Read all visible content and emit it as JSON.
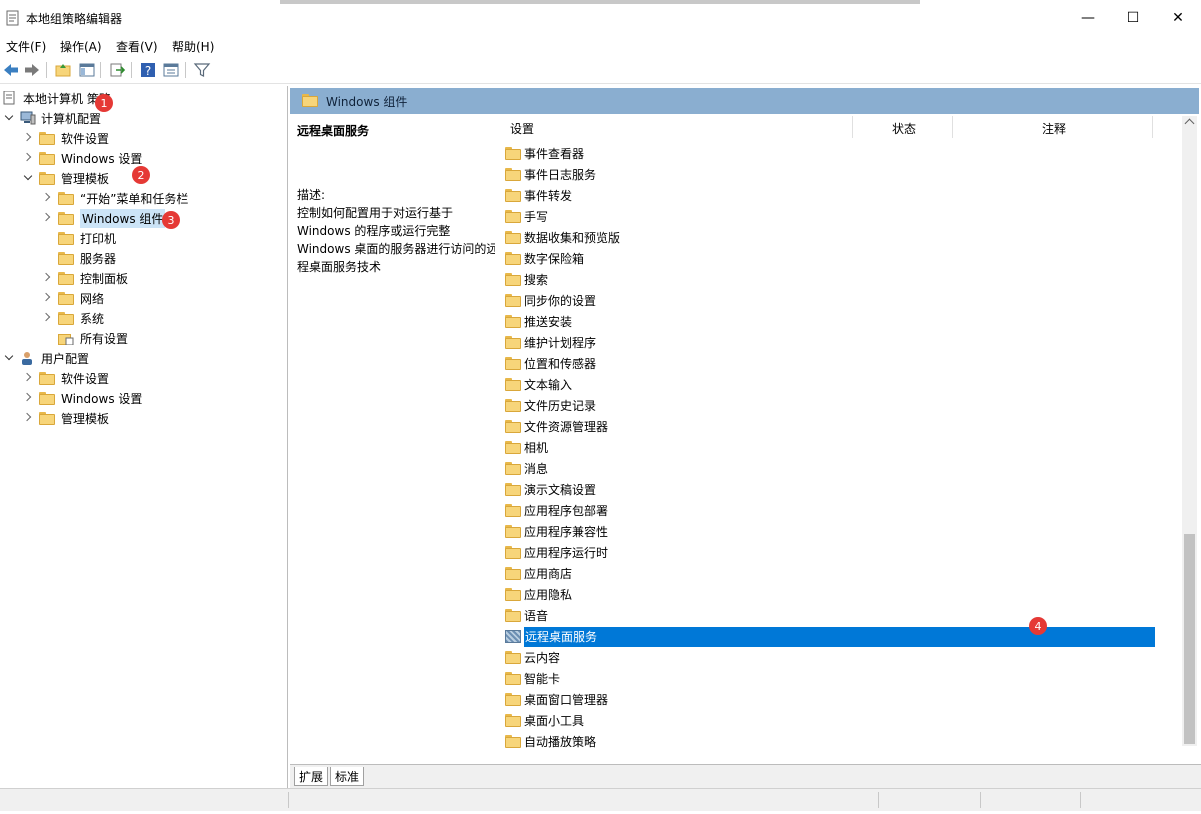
{
  "window": {
    "title": "本地组策略编辑器",
    "minimize": "—",
    "maximize": "☐",
    "close": "✕"
  },
  "menu": [
    "文件(F)",
    "操作(A)",
    "查看(V)",
    "帮助(H)"
  ],
  "toolbar": {
    "icons": [
      "back-arrow-icon",
      "forward-arrow-icon",
      "up-folder-icon",
      "show-hide-tree-icon",
      "export-list-icon",
      "help-icon",
      "properties-icon",
      "filter-icon"
    ]
  },
  "tree": {
    "root": "本地计算机 策略",
    "items": [
      {
        "label": "计算机配置"
      },
      {
        "label": "软件设置"
      },
      {
        "label": "Windows 设置"
      },
      {
        "label": "管理模板"
      },
      {
        "label": "“开始”菜单和任务栏"
      },
      {
        "label": "Windows 组件"
      },
      {
        "label": "打印机"
      },
      {
        "label": "服务器"
      },
      {
        "label": "控制面板"
      },
      {
        "label": "网络"
      },
      {
        "label": "系统"
      },
      {
        "label": "所有设置"
      },
      {
        "label": "用户配置"
      },
      {
        "label": "软件设置"
      },
      {
        "label": "Windows 设置"
      },
      {
        "label": "管理模板"
      }
    ]
  },
  "badges": [
    "1",
    "2",
    "3",
    "4"
  ],
  "right": {
    "header_title": "Windows 组件",
    "desc_title": "远程桌面服务",
    "desc_label": "描述:",
    "desc_body": "控制如何配置用于对运行基于 Windows 的程序或运行完整 Windows 桌面的服务器进行访问的远程桌面服务技术",
    "columns": [
      "设置",
      "状态",
      "注释"
    ],
    "rows": [
      "事件查看器",
      "事件日志服务",
      "事件转发",
      "手写",
      "数据收集和预览版",
      "数字保险箱",
      "搜索",
      "同步你的设置",
      "推送安装",
      "维护计划程序",
      "位置和传感器",
      "文本输入",
      "文件历史记录",
      "文件资源管理器",
      "相机",
      "消息",
      "演示文稿设置",
      "应用程序包部署",
      "应用程序兼容性",
      "应用程序运行时",
      "应用商店",
      "应用隐私",
      "语音",
      "远程桌面服务",
      "云内容",
      "智能卡",
      "桌面窗口管理器",
      "桌面小工具",
      "自动播放策略"
    ],
    "selected_row": "远程桌面服务",
    "tabs": [
      "扩展",
      "标准"
    ]
  },
  "colors": {
    "header_bg": "#8aaed0",
    "selection": "#0078d7",
    "badge": "#e53935",
    "tree_selection": "#cce4f7"
  }
}
